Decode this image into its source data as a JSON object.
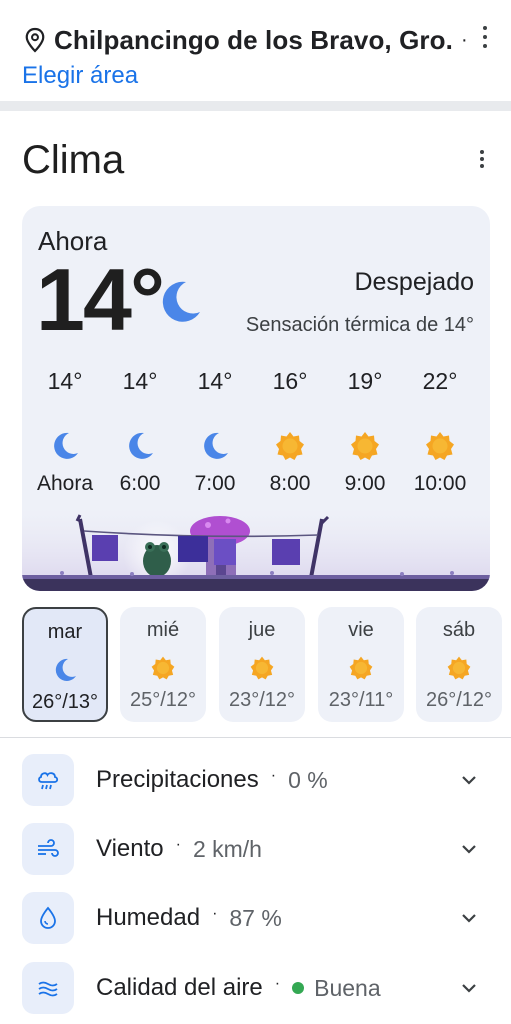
{
  "location": {
    "name": "Chilpancingo de los Bravo, Gro.",
    "separator": "·",
    "choose_area": "Elegir área"
  },
  "weather": {
    "title": "Clima",
    "now_label": "Ahora",
    "current_temp": "14°",
    "condition": "Despejado",
    "feels_like": "Sensación térmica de 14°",
    "current_icon": "moon-icon"
  },
  "hourly": [
    {
      "temp": "14°",
      "icon": "moon-icon",
      "time": "Ahora"
    },
    {
      "temp": "14°",
      "icon": "moon-icon",
      "time": "6:00"
    },
    {
      "temp": "14°",
      "icon": "moon-icon",
      "time": "7:00"
    },
    {
      "temp": "16°",
      "icon": "sun-icon",
      "time": "8:00"
    },
    {
      "temp": "19°",
      "icon": "sun-icon",
      "time": "9:00"
    },
    {
      "temp": "22°",
      "icon": "sun-icon",
      "time": "10:00"
    }
  ],
  "daily": [
    {
      "day": "mar",
      "icon": "moon-icon",
      "range": "26°/13°",
      "selected": true
    },
    {
      "day": "mié",
      "icon": "sun-icon",
      "range": "25°/12°",
      "selected": false
    },
    {
      "day": "jue",
      "icon": "sun-icon",
      "range": "23°/12°",
      "selected": false
    },
    {
      "day": "vie",
      "icon": "sun-icon",
      "range": "23°/11°",
      "selected": false
    },
    {
      "day": "sáb",
      "icon": "sun-icon",
      "range": "26°/12°",
      "selected": false
    }
  ],
  "details": [
    {
      "label": "Precipitaciones",
      "value": "0 %",
      "icon": "rain-cloud-icon"
    },
    {
      "label": "Viento",
      "value": "2 km/h",
      "icon": "wind-icon"
    },
    {
      "label": "Humedad",
      "value": "87 %",
      "icon": "water-drop-icon"
    },
    {
      "label": "Calidad del aire",
      "value": "Buena",
      "icon": "air-quality-icon"
    }
  ],
  "colors": {
    "accent_blue": "#1a73e8",
    "moon": "#4a86e8",
    "sun": "#f5a623",
    "card_bg": "#eef1f8",
    "air_good": "#34a853"
  }
}
